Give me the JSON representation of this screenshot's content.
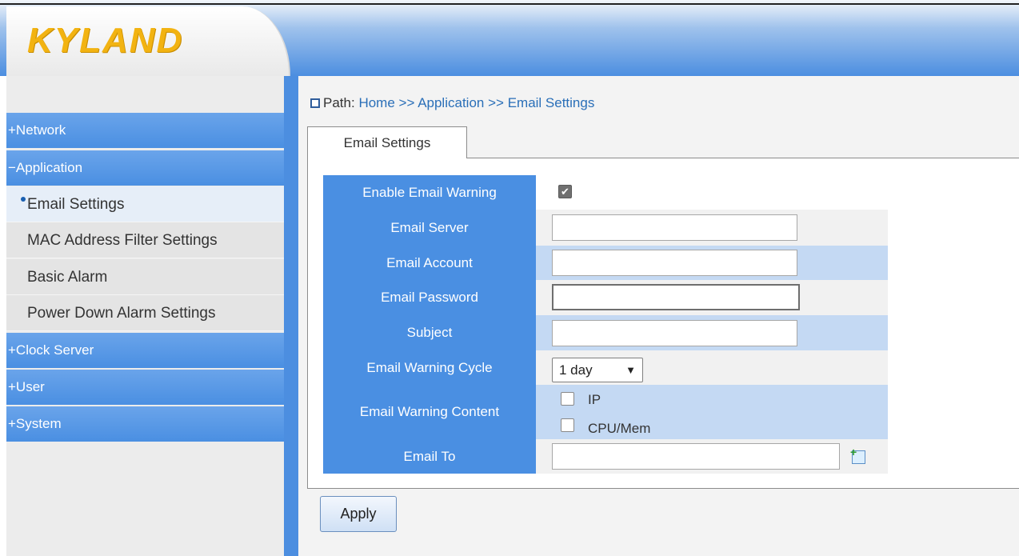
{
  "app": {
    "logo": "KYLAND"
  },
  "sidebar": {
    "groups": [
      {
        "label": "+Network"
      },
      {
        "label": "−Application"
      },
      {
        "label": "+Clock Server"
      },
      {
        "label": "+User"
      },
      {
        "label": "+System"
      }
    ],
    "sub_items": [
      {
        "label": "Email Settings",
        "active": true
      },
      {
        "label": "MAC Address Filter Settings"
      },
      {
        "label": "Basic Alarm"
      },
      {
        "label": "Power Down Alarm Settings"
      }
    ]
  },
  "breadcrumb": {
    "prefix": "Path:",
    "items": [
      "Home",
      ">>",
      "Application",
      ">>",
      "Email Settings"
    ]
  },
  "tab": {
    "label": "Email Settings"
  },
  "form": {
    "enable_label": "Enable Email Warning",
    "enable_checked": true,
    "server_label": "Email Server",
    "server_value": "",
    "account_label": "Email Account",
    "account_value": "",
    "password_label": "Email Password",
    "password_value": "",
    "subject_label": "Subject",
    "subject_value": "",
    "cycle_label": "Email Warning Cycle",
    "cycle_value": "1 day",
    "content_label": "Email Warning Content",
    "content_options": [
      {
        "label": "IP",
        "checked": false
      },
      {
        "label": "CPU/Mem",
        "checked": false
      }
    ],
    "to_label": "Email To",
    "to_value": ""
  },
  "buttons": {
    "apply": "Apply"
  },
  "icons": {
    "checkmark": "✔",
    "dropdown": "⌄",
    "add": "+"
  },
  "colors": {
    "accent": "#4a8fe2",
    "row_alt": "#c4d9f3",
    "logo": "#f2b312"
  }
}
